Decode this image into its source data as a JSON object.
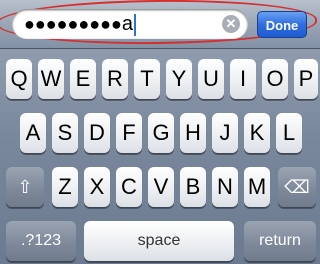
{
  "search": {
    "masked_text": "●●●●●●●●●",
    "last_char": "a",
    "clear_icon": "clear-icon"
  },
  "done_label": "Done",
  "row1": [
    "Q",
    "W",
    "E",
    "R",
    "T",
    "Y",
    "U",
    "I",
    "O",
    "P"
  ],
  "row2": [
    "A",
    "S",
    "D",
    "F",
    "G",
    "H",
    "J",
    "K",
    "L"
  ],
  "row3": [
    "Z",
    "X",
    "C",
    "V",
    "B",
    "N",
    "M"
  ],
  "shift_icon": "⇧",
  "delete_icon": "⌫",
  "numbers_label": ".?123",
  "space_label": "space",
  "return_label": "return",
  "colors": {
    "done_button": "#2f6ee0",
    "highlight": "#d43030"
  }
}
